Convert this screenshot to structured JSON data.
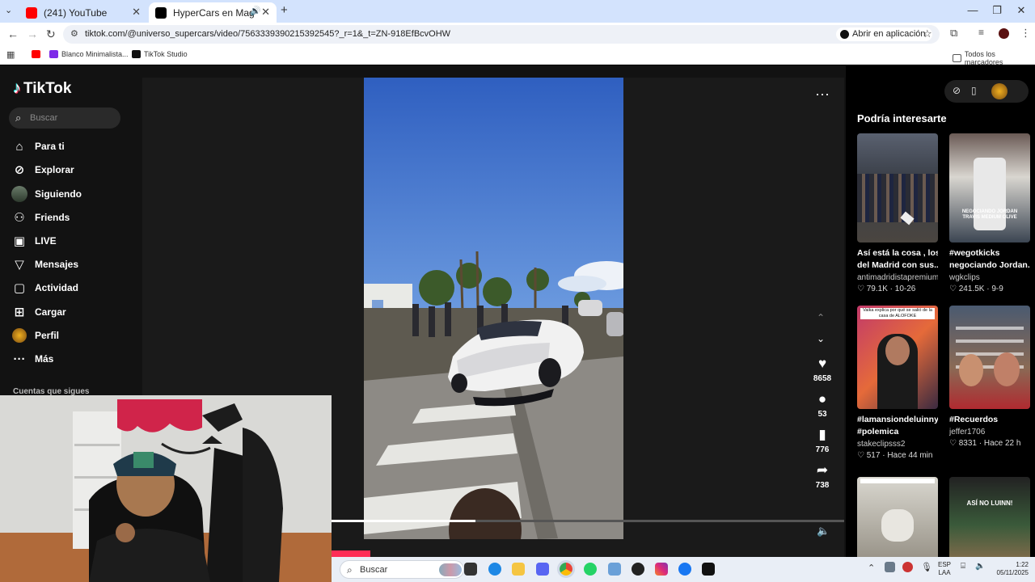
{
  "browser": {
    "tabs": [
      {
        "title": "(241) YouTube",
        "favicon": "youtube-icon",
        "color": "#ff0000"
      },
      {
        "title": "HyperCars en Magna Marbe",
        "favicon": "tiktok-icon",
        "color": "#000000",
        "active": true
      }
    ],
    "new_tab": "+",
    "url": "tiktok.com/@universo_supercars/video/7563339390215392545?_r=1&_t=ZN-918EfBcvOHW",
    "open_app": "Abrir en aplicación",
    "bookmarks": [
      {
        "label": "",
        "icon": "youtube-icon"
      },
      {
        "label": "Blanco Minimalista...",
        "icon": "canva-icon"
      },
      {
        "label": "TikTok Studio",
        "icon": "tiktok-icon"
      }
    ],
    "all_bookmarks": "Todos los marcadores"
  },
  "tiktok": {
    "logo": "TikTok",
    "search_placeholder": "Buscar",
    "nav": [
      {
        "label": "Para ti",
        "icon": "home-icon"
      },
      {
        "label": "Explorar",
        "icon": "compass-icon"
      },
      {
        "label": "Siguiendo",
        "icon": "following-avatar-icon"
      },
      {
        "label": "Friends",
        "icon": "friends-icon"
      },
      {
        "label": "LIVE",
        "icon": "live-icon"
      },
      {
        "label": "Mensajes",
        "icon": "messages-icon"
      },
      {
        "label": "Actividad",
        "icon": "activity-icon"
      },
      {
        "label": "Cargar",
        "icon": "upload-icon"
      },
      {
        "label": "Perfil",
        "icon": "profile-avatar-icon"
      },
      {
        "label": "Más",
        "icon": "more-icon"
      }
    ],
    "following_heading": "Cuentas que sigues",
    "actions": {
      "likes": "8658",
      "comments": "53",
      "saves": "776",
      "shares": "738"
    },
    "progress": 0.28,
    "recommend_title": "Podría interesarte",
    "cards": [
      {
        "caption1": "Así está la cosa , los",
        "caption2": "del Madrid con sus...",
        "author": "antimadridistapremium",
        "meta": "♡ 79.1K · 10-26"
      },
      {
        "caption1": "#wegotkicks",
        "caption2": "negociando Jordan...",
        "author": "wgkclips",
        "meta": "♡ 241.5K · 9-9"
      },
      {
        "caption1": "#lamansiondeluinny",
        "caption2": "#polemica",
        "author": "stakeclipsss2",
        "meta": "♡ 517 · Hace 44 min"
      },
      {
        "caption1": "#Recuerdos",
        "caption2": "",
        "author": "jeffer1706",
        "meta": "♡ 8331 · Hace 22 h"
      }
    ],
    "thumb_texts": {
      "card2": "NEGOCIANDO JORDAN TRAVIS MEDIUM OLIVE",
      "card3": "Vaika explica por qué se salió de la casa de ALOFOKE",
      "card6": "ASÍ NO LUINN!"
    }
  },
  "taskbar": {
    "search": "Buscar",
    "lang1": "ESP",
    "lang2": "LAA",
    "time": "1:22",
    "date": "05/11/2025"
  }
}
